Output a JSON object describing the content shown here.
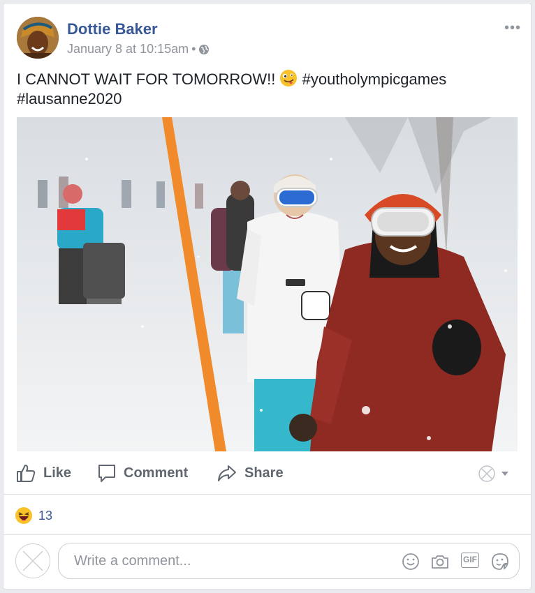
{
  "post": {
    "author": "Dottie Baker",
    "timestamp": "January 8 at 10:15am",
    "separator": "•",
    "text_before_emoji": "I CANNOT WAIT FOR TOMORROW!!",
    "text_after_emoji": "#youtholympicgames #lausanne2020",
    "emoji_icon": "zany-face-emoji",
    "privacy_icon": "globe-icon",
    "more_label": "•••"
  },
  "actions": {
    "like_label": "Like",
    "comment_label": "Comment",
    "share_label": "Share"
  },
  "reactions": {
    "icon": "laughing-emoji",
    "count": "13"
  },
  "comment_box": {
    "placeholder": "Write a comment...",
    "tools": [
      "smiley-icon",
      "camera-icon",
      "gif-icon",
      "sticker-icon"
    ],
    "gif_label": "GIF"
  },
  "colors": {
    "author": "#385898",
    "meta": "#90949c",
    "action": "#606770"
  }
}
